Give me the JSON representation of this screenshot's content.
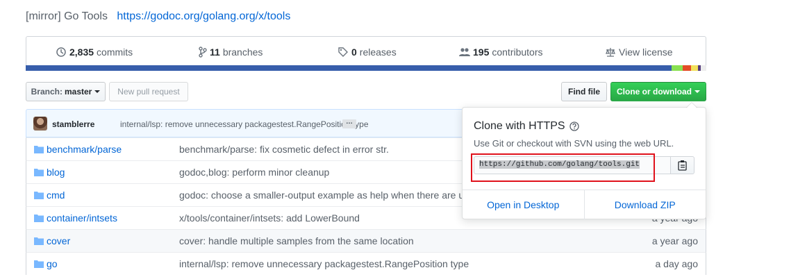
{
  "repo": {
    "description": "[mirror] Go Tools",
    "homepage": "https://godoc.org/golang.org/x/tools"
  },
  "summary": {
    "commits": {
      "count": "2,835",
      "label": "commits",
      "icon": "history-icon"
    },
    "branches": {
      "count": "11",
      "label": "branches",
      "icon": "git-branch-icon"
    },
    "releases": {
      "count": "0",
      "label": "releases",
      "icon": "tag-icon"
    },
    "contributors": {
      "count": "195",
      "label": "contributors",
      "icon": "people-icon"
    },
    "license": {
      "label": "View license",
      "icon": "law-icon"
    }
  },
  "language_colors": [
    "#375eab",
    "#89e051",
    "#e34c26",
    "#f1e05a",
    "#563d7c"
  ],
  "toolbar": {
    "branch_prefix": "Branch:",
    "branch_name": "master",
    "new_pull_request": "New pull request",
    "find_file": "Find file",
    "clone_or_download": "Clone or download"
  },
  "latest_commit": {
    "author": "stamblerre",
    "message": "internal/lsp: remove unnecessary packagestest.RangePosition type",
    "ellipsis": "…"
  },
  "files": [
    {
      "name": "benchmark/",
      "name_link": "parse",
      "message": "benchmark/parse: fix cosmetic defect in error str.",
      "age": ""
    },
    {
      "name": "blog",
      "name_link": "",
      "message": "godoc,blog: perform minor cleanup",
      "age": ""
    },
    {
      "name": "cmd",
      "name_link": "",
      "message": "godoc: choose a smaller-output example as help when there are u",
      "age": ""
    },
    {
      "name": "container/",
      "name_link": "intsets",
      "message": "x/tools/container/intsets: add LowerBound",
      "age": "a year ago"
    },
    {
      "name": "cover",
      "name_link": "",
      "message": "cover: handle multiple samples from the same location",
      "age": "a year ago"
    },
    {
      "name": "go",
      "name_link": "",
      "message": "internal/lsp: remove unnecessary packagestest.RangePosition type",
      "age": "a day ago"
    }
  ],
  "clone_dropdown": {
    "title": "Clone with HTTPS",
    "help": "Use Git or checkout with SVN using the web URL.",
    "url": "https://github.com/golang/tools.git",
    "open_desktop": "Open in Desktop",
    "download_zip": "Download ZIP"
  }
}
